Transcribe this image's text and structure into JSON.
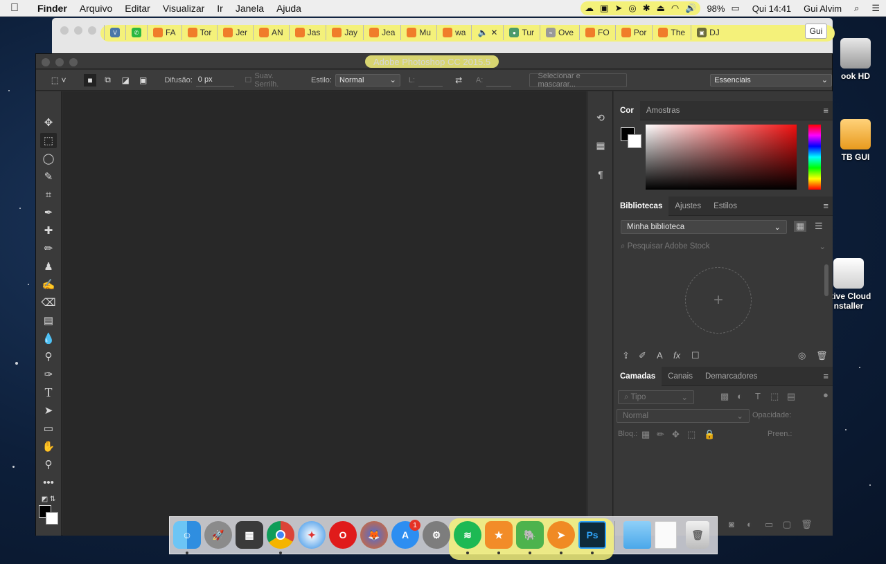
{
  "menubar": {
    "apple": "",
    "app_name": "Finder",
    "menus": [
      "Arquivo",
      "Editar",
      "Visualizar",
      "Ir",
      "Janela",
      "Ajuda"
    ],
    "battery": "98%",
    "clock": "Qui 14:41",
    "user": "Gui Alvim"
  },
  "desktop": {
    "icons": [
      {
        "label": "ook HD"
      },
      {
        "label": "TB GUI"
      },
      {
        "label_1": "ative Cloud",
        "label_2": "nstaller"
      }
    ]
  },
  "chrome": {
    "tabs": [
      "FA",
      "Tor",
      "Jer",
      "AN",
      "Jas",
      "Jay",
      "Jea",
      "Mu",
      "wa",
      "",
      "Tur",
      "Ove",
      "FO",
      "Por",
      "The",
      "DJ"
    ],
    "profile": "Gui"
  },
  "photoshop": {
    "title": "Adobe Photoshop CC 2015.5",
    "options": {
      "feather_label": "Difusão:",
      "feather_value": "0 px",
      "antialias_label": "Suav. Serrilh.",
      "style_label": "Estilo:",
      "style_value": "Normal",
      "width_label": "L:",
      "height_label": "A:",
      "select_mask": "Selecionar e mascarar...",
      "workspace": "Essenciais"
    },
    "color_panel": {
      "tabs": [
        "Cor",
        "Amostras"
      ]
    },
    "libraries_panel": {
      "tabs": [
        "Bibliotecas",
        "Ajustes",
        "Estilos"
      ],
      "library": "Minha biblioteca",
      "search_placeholder": "Pesquisar Adobe Stock",
      "plus": "+"
    },
    "layers_panel": {
      "tabs": [
        "Camadas",
        "Canais",
        "Demarcadores"
      ],
      "kind": "Tipo",
      "blend": "Normal",
      "opacity_label": "Opacidade:",
      "lock_label": "Bloq.:",
      "fill_label": "Preen.:"
    }
  },
  "dock": {
    "apps": [
      "Finder",
      "Launchpad",
      "Photo Slideshow",
      "Chrome",
      "Safari",
      "Opera",
      "Firefox",
      "App Store",
      "System Preferences",
      "Spotify",
      "Reeder",
      "Evernote",
      "Airmail",
      "Photoshop",
      "Downloads",
      "Document",
      "Trash"
    ],
    "appstore_badge": "1",
    "ps_label": "Ps"
  }
}
